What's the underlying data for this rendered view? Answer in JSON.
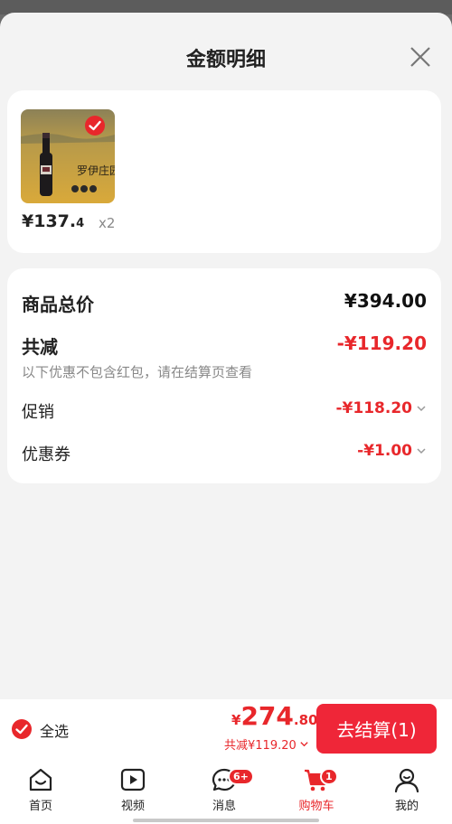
{
  "sheet": {
    "title": "金额明细"
  },
  "product": {
    "price_symbol": "¥",
    "price_int": "137.",
    "price_frac": "4",
    "quantity": "x2",
    "image_text_line1": "du",
    "image_text_line2": "Noy",
    "image_text_cn": "罗伊庄园"
  },
  "summary": {
    "total_label": "商品总价",
    "total_value": "¥394.00",
    "reduce_label": "共减",
    "reduce_value": "-¥119.20",
    "reduce_note": "以下优惠不包含红包，请在结算页查看",
    "promo_label": "促销",
    "promo_value": "-¥118.20",
    "coupon_label": "优惠券",
    "coupon_value": "-¥1.00"
  },
  "checkout": {
    "select_all": "全选",
    "currency": "¥",
    "total_int": "274",
    "total_frac": ".80",
    "saved": "共减¥119.20",
    "button": "去结算(1)"
  },
  "tabs": [
    {
      "label": "首页",
      "icon": "home-icon"
    },
    {
      "label": "视频",
      "icon": "video-icon"
    },
    {
      "label": "消息",
      "icon": "message-icon",
      "badge": "6+"
    },
    {
      "label": "购物车",
      "icon": "cart-icon",
      "badge": "1"
    },
    {
      "label": "我的",
      "icon": "profile-icon"
    }
  ],
  "colors": {
    "accent": "#e8272b",
    "button": "#ef2638"
  }
}
